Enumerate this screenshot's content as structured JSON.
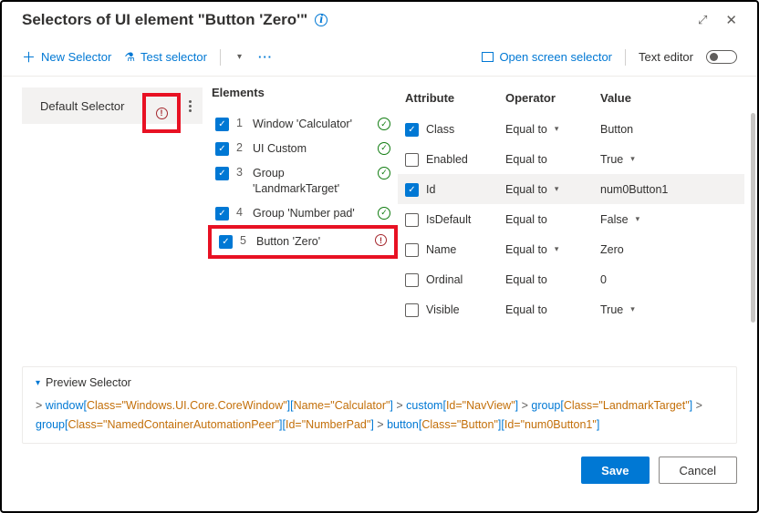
{
  "title": "Selectors of UI element \"Button 'Zero'\"",
  "toolbar": {
    "new_selector": "New Selector",
    "test_selector": "Test selector",
    "open_screen": "Open screen selector",
    "text_editor": "Text editor"
  },
  "sidebar": {
    "default_selector": "Default Selector"
  },
  "elements": {
    "heading": "Elements",
    "items": [
      {
        "num": "1",
        "label": "Window 'Calculator'",
        "status": "ok"
      },
      {
        "num": "2",
        "label": "UI Custom",
        "status": "ok"
      },
      {
        "num": "3",
        "label": "Group 'LandmarkTarget'",
        "status": "ok"
      },
      {
        "num": "4",
        "label": "Group 'Number pad'",
        "status": "ok"
      },
      {
        "num": "5",
        "label": "Button 'Zero'",
        "status": "error"
      }
    ]
  },
  "attr_head": {
    "c1": "Attribute",
    "c2": "Operator",
    "c3": "Value"
  },
  "attributes": [
    {
      "checked": true,
      "name": "Class",
      "op": "Equal to",
      "op_chev": true,
      "value": "Button",
      "val_chev": false,
      "selected": false
    },
    {
      "checked": false,
      "name": "Enabled",
      "op": "Equal to",
      "op_chev": false,
      "value": "True",
      "val_chev": true,
      "selected": false
    },
    {
      "checked": true,
      "name": "Id",
      "op": "Equal to",
      "op_chev": true,
      "value": "num0Button1",
      "val_chev": false,
      "selected": true
    },
    {
      "checked": false,
      "name": "IsDefault",
      "op": "Equal to",
      "op_chev": false,
      "value": "False",
      "val_chev": true,
      "selected": false
    },
    {
      "checked": false,
      "name": "Name",
      "op": "Equal to",
      "op_chev": true,
      "value": "Zero",
      "val_chev": false,
      "selected": false
    },
    {
      "checked": false,
      "name": "Ordinal",
      "op": "Equal to",
      "op_chev": false,
      "value": "0",
      "val_chev": false,
      "selected": false
    },
    {
      "checked": false,
      "name": "Visible",
      "op": "Equal to",
      "op_chev": false,
      "value": "True",
      "val_chev": true,
      "selected": false
    }
  ],
  "preview": {
    "label": "Preview Selector",
    "parts": [
      {
        "tag": "window",
        "attrs": "[Class=\"Windows.UI.Core.CoreWindow\"][Name=\"Calculator\"]"
      },
      {
        "tag": "custom",
        "attrs": "[Id=\"NavView\"]"
      },
      {
        "tag": "group",
        "attrs": "[Class=\"LandmarkTarget\"]"
      },
      {
        "tag": "group",
        "attrs": "[Class=\"NamedContainerAutomationPeer\"][Id=\"NumberPad\"]"
      },
      {
        "tag": "button",
        "attrs": "[Class=\"Button\"][Id=\"num0Button1\"]"
      }
    ]
  },
  "footer": {
    "save": "Save",
    "cancel": "Cancel"
  }
}
